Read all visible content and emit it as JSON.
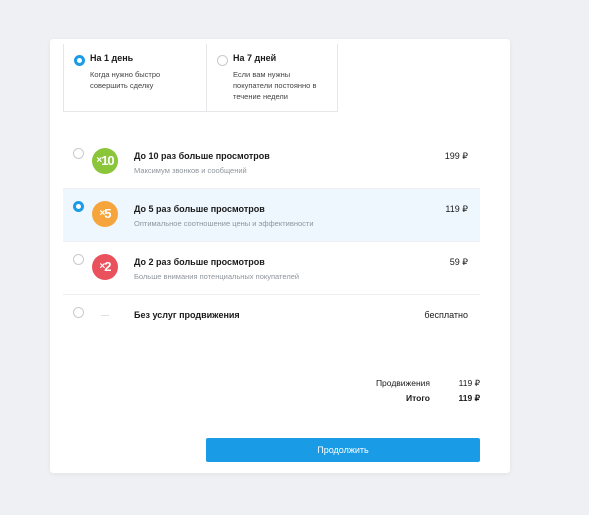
{
  "durations": [
    {
      "title": "На 1 день",
      "desc": "Когда нужно быстро совершить сделку",
      "selected": true
    },
    {
      "title": "На 7 дней",
      "desc": "Если вам нужны покупатели постоянно в течение недели",
      "selected": false
    }
  ],
  "options": [
    {
      "badge": "10",
      "title": "До 10 раз больше просмотров",
      "desc": "Максимум звонков и сообщений",
      "price": "199 ₽",
      "color": "#8ac53a",
      "selected": false
    },
    {
      "badge": "5",
      "title": "До 5 раз больше просмотров",
      "desc": "Оптимальное соотношение цены и эффективности",
      "price": "119 ₽",
      "color": "#f5a53c",
      "selected": true
    },
    {
      "badge": "2",
      "title": "До 2 раз больше просмотров",
      "desc": "Больше внимания потенциальных покупателей",
      "price": "59 ₽",
      "color": "#e9525d",
      "selected": false
    },
    {
      "title": "Без услуг продвижения",
      "price": "бесплатно",
      "selected": false
    }
  ],
  "summary": {
    "promo_label": "Продвижения",
    "promo_value": "119 ₽",
    "total_label": "Итого",
    "total_value": "119 ₽"
  },
  "cta_label": "Продолжить",
  "colors": {
    "accent": "#1a9be6",
    "selected_row": "#eef7fd"
  }
}
